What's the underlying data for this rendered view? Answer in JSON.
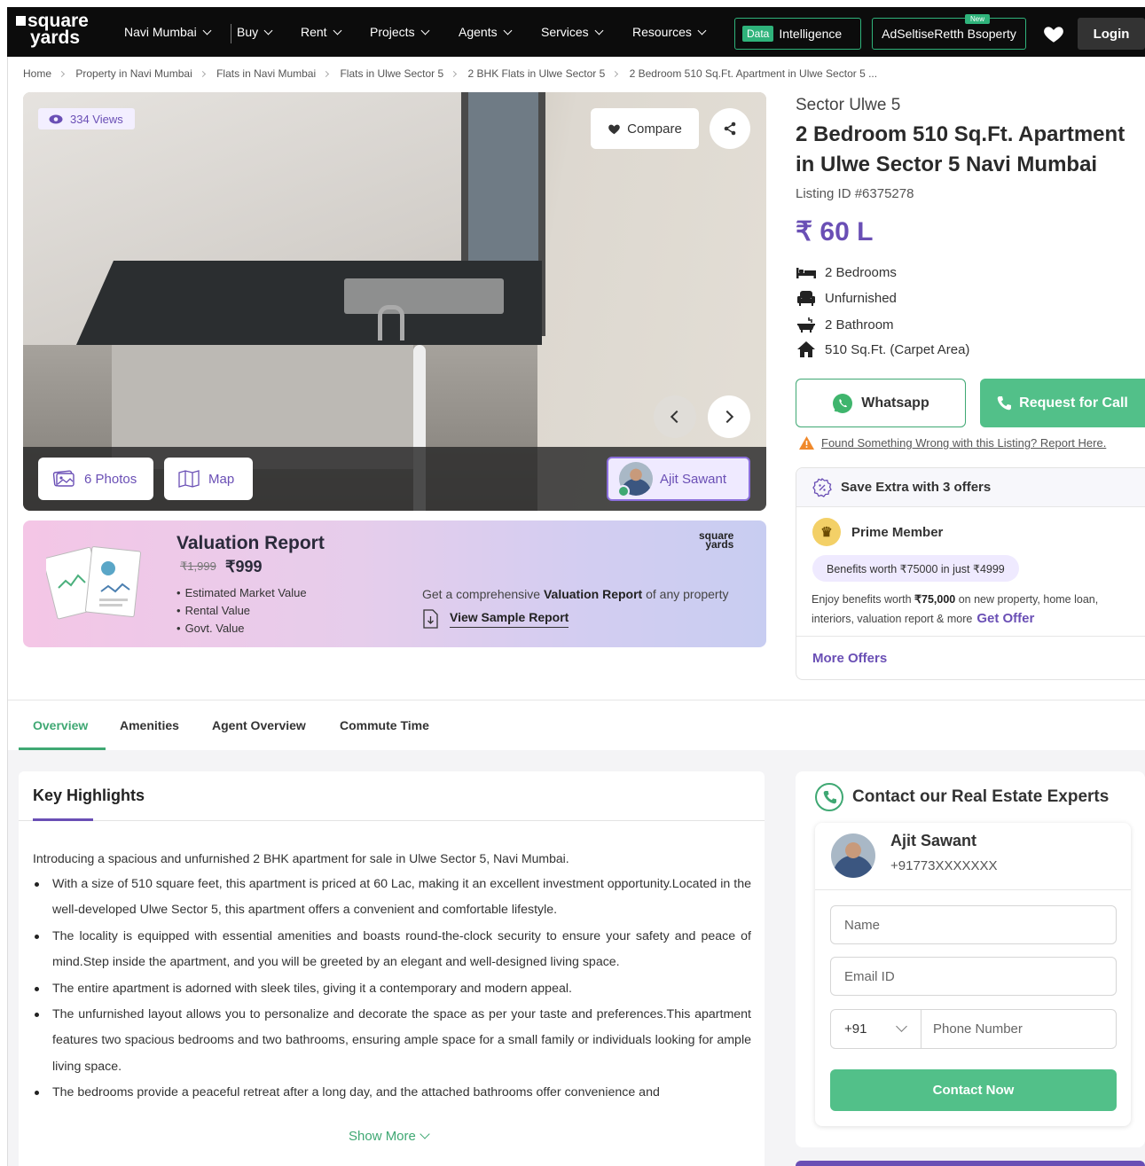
{
  "nav": {
    "logo_line1": "square",
    "logo_line2": "yards",
    "city": "Navi Mumbai",
    "items": [
      "Buy",
      "Rent",
      "Projects",
      "Agents",
      "Services",
      "Resources"
    ],
    "data_badge": "Data",
    "intelligence": "Intelligence",
    "sell_label": "AdSeltiseRetth Bsoperty",
    "new_badge": "New",
    "login": "Login",
    "accent_color": "#2fb37b"
  },
  "breadcrumb": [
    "Home",
    "Property in Navi Mumbai",
    "Flats in Navi Mumbai",
    "Flats in Ulwe Sector 5",
    "2 BHK Flats in Ulwe Sector 5",
    "2 Bedroom 510 Sq.Ft. Apartment in Ulwe Sector 5 ..."
  ],
  "gallery": {
    "views": "334 Views",
    "compare": "Compare",
    "photos": "6 Photos",
    "map": "Map",
    "agent": "Ajit Sawant"
  },
  "valuation": {
    "title": "Valuation Report",
    "old_price": "₹1,999",
    "new_price": "₹999",
    "points": [
      "Estimated Market Value",
      "Rental Value",
      "Govt. Value"
    ],
    "desc_pre": "Get a comprehensive ",
    "desc_bold": "Valuation Report",
    "desc_post": " of any property",
    "sample": "View Sample Report",
    "logo1": "square",
    "logo2": "yards"
  },
  "property": {
    "location": "Sector Ulwe 5",
    "title": "2 Bedroom 510 Sq.Ft. Apartment in Ulwe Sector 5 Navi Mumbai",
    "listing_id": "Listing ID #6375278",
    "price": "₹ 60 L",
    "specs": [
      "2 Bedrooms",
      "Unfurnished",
      "2 Bathroom",
      "510 Sq.Ft. (Carpet Area)"
    ],
    "spec_icons": [
      "bed-icon",
      "sofa-icon",
      "bathtub-icon",
      "home-icon"
    ],
    "whatsapp": "Whatsapp",
    "request_call": "Request for Call",
    "report": "Found Something Wrong with this Listing? Report Here."
  },
  "offers": {
    "header": "Save Extra with 3 offers",
    "prime": "Prime Member",
    "pill": "Benefits worth ₹75000 in just ₹4999",
    "text_pre": "Enjoy benefits worth ",
    "text_bold": "₹75,000",
    "text_post": " on new property, home loan, interiors, valuation report & more",
    "get_offer": "Get Offer",
    "more": "More Offers"
  },
  "tabs": [
    "Overview",
    "Amenities",
    "Agent Overview",
    "Commute Time"
  ],
  "highlights": {
    "title": "Key Highlights",
    "intro": "Introducing a spacious and unfurnished 2 BHK apartment for sale in Ulwe Sector 5, Navi Mumbai.",
    "points": [
      "With a size of 510 square feet, this apartment is priced at 60 Lac, making it an excellent investment opportunity.Located in the well-developed Ulwe Sector 5, this apartment offers a convenient and comfortable lifestyle.",
      "The locality is equipped with essential amenities and boasts round-the-clock security to ensure your safety and peace of mind.Step inside the apartment, and you will be greeted by an elegant and well-designed living space.",
      "The entire apartment is adorned with sleek tiles, giving it a contemporary and modern appeal.",
      "The unfurnished layout allows you to personalize and decorate the space as per your taste and preferences.This apartment features two spacious bedrooms and two bathrooms, ensuring ample space for a small family or individuals looking for ample living space.",
      "The bedrooms provide a peaceful retreat after a long day, and the attached bathrooms offer convenience and"
    ],
    "show_more": "Show More"
  },
  "contact": {
    "title": "Contact our Real Estate Experts",
    "agent_name": "Ajit Sawant",
    "agent_phone": "+91773XXXXXXX",
    "name_ph": "Name",
    "email_ph": "Email ID",
    "country_code": "+91",
    "phone_ph": "Phone Number",
    "submit": "Contact Now"
  }
}
